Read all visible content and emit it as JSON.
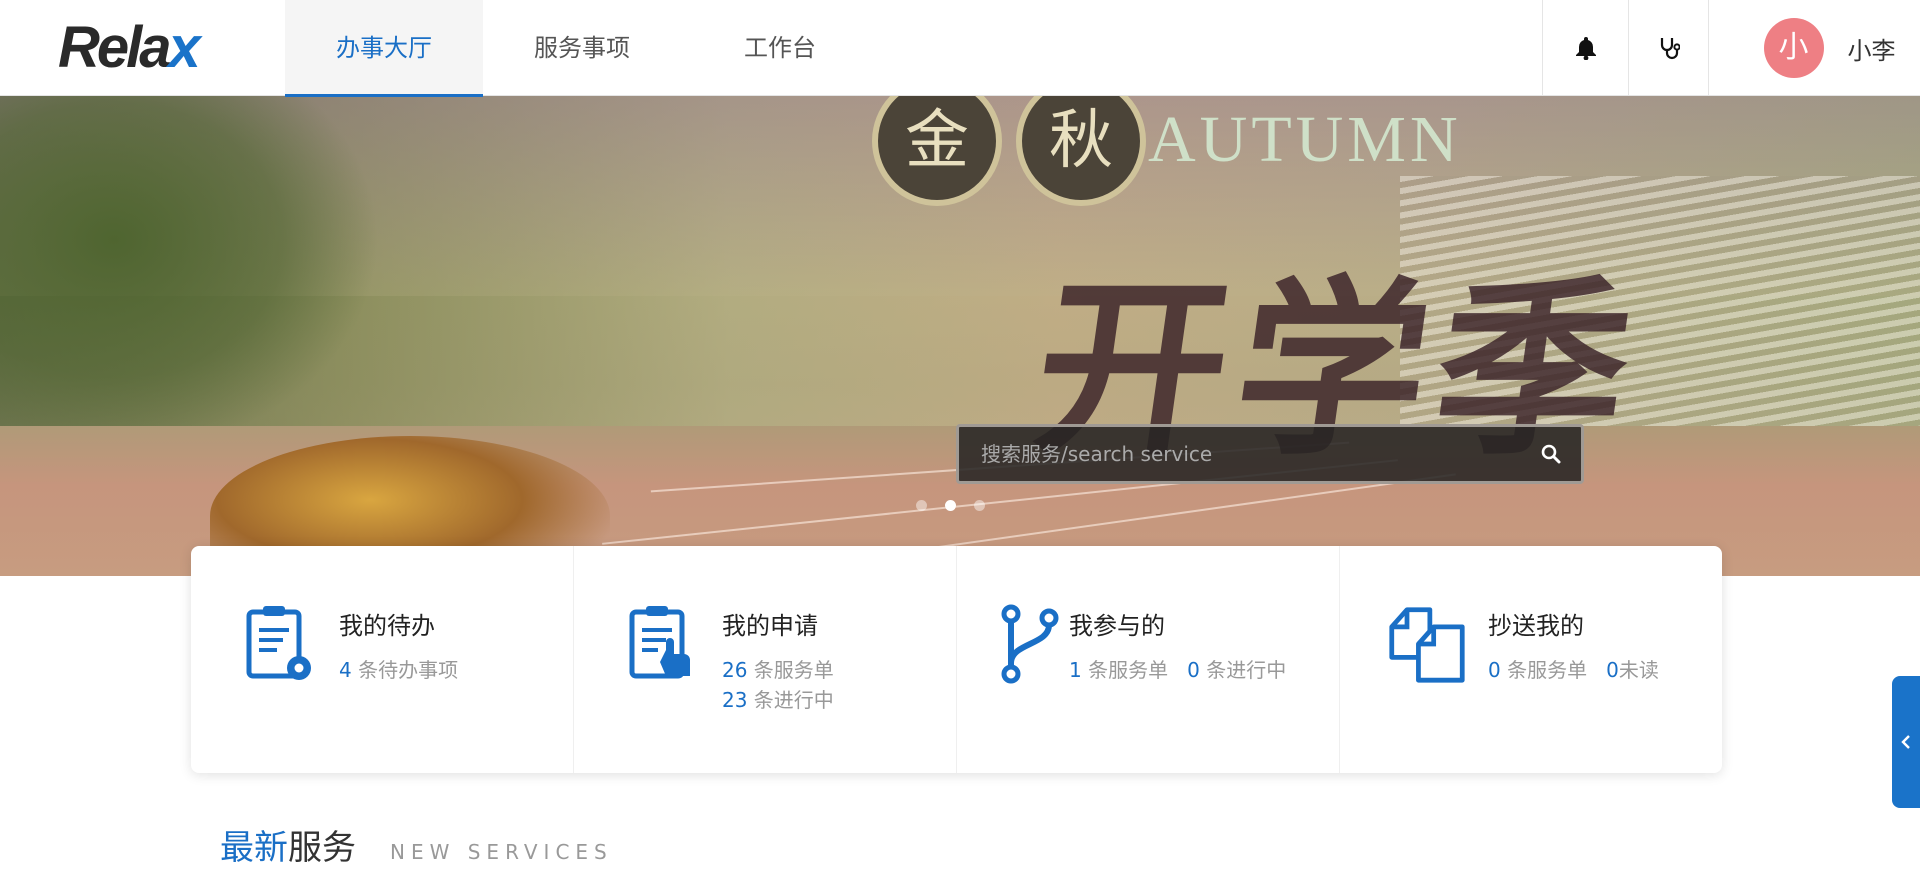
{
  "header": {
    "logo": "Rela",
    "logo_x": "x",
    "tabs": [
      {
        "label": "办事大厅",
        "active": true
      },
      {
        "label": "服务事项",
        "active": false
      },
      {
        "label": "工作台",
        "active": false
      }
    ],
    "icons": {
      "bell": "bell-icon",
      "stethoscope": "stethoscope-icon"
    },
    "user": {
      "avatar_text": "小",
      "name": "小李",
      "avatar_color": "#ee7f84"
    }
  },
  "banner": {
    "medal_1": "金",
    "medal_2": "秋",
    "autumn": "AUTUMN",
    "calligraphy": "开学季",
    "search": {
      "placeholder": "搜索服务/search service",
      "icon": "search-icon"
    },
    "carousel": {
      "count": 3,
      "active": 2
    }
  },
  "cards": [
    {
      "icon": "todo-gear-icon",
      "title": "我的待办",
      "lines": [
        {
          "num": "4",
          "text": " 条待办事项"
        }
      ]
    },
    {
      "icon": "apply-hand-icon",
      "title": "我的申请",
      "lines": [
        {
          "num": "26",
          "text": " 条服务单"
        },
        {
          "num": "23",
          "text": " 条进行中"
        }
      ]
    },
    {
      "icon": "branch-icon",
      "title": "我参与的",
      "lines": [
        {
          "num": "1",
          "text": " 条服务单",
          "num2": "0",
          "text2": " 条进行中"
        }
      ]
    },
    {
      "icon": "copy-docs-icon",
      "title": "抄送我的",
      "lines": [
        {
          "num": "0",
          "text": " 条服务单",
          "num2": "0",
          "text2": "未读"
        }
      ]
    }
  ],
  "section": {
    "title_a": "最新",
    "title_b": "服务",
    "subtitle": "NEW SERVICES"
  },
  "colors": {
    "accent": "#1a6fc6",
    "side_tab": "#1a73c9"
  }
}
